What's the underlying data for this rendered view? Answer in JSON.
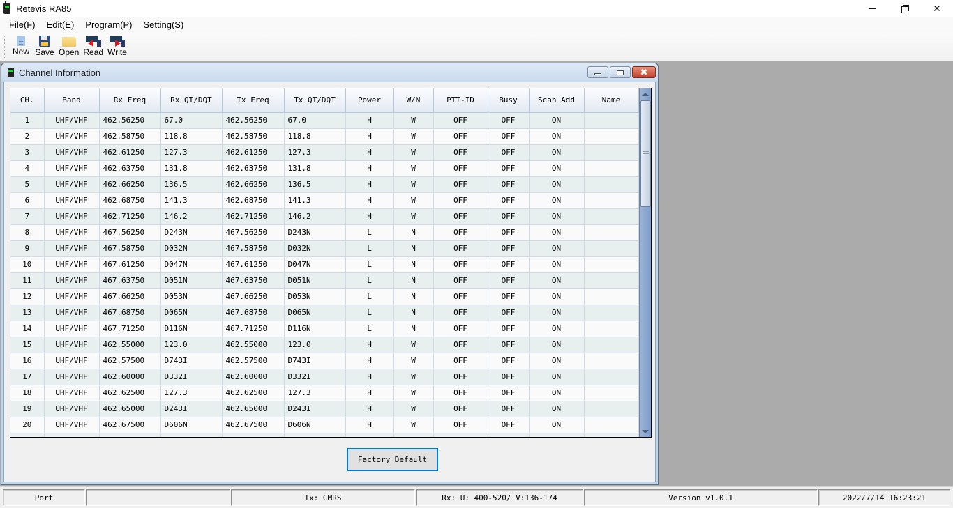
{
  "app": {
    "title": "Retevis RA85",
    "controls": {
      "minimize": "minimize",
      "restore": "restore",
      "close": "✕"
    }
  },
  "menubar": {
    "items": [
      {
        "label": "File(F)"
      },
      {
        "label": "Edit(E)"
      },
      {
        "label": "Program(P)"
      },
      {
        "label": "Setting(S)"
      }
    ]
  },
  "toolbar": {
    "items": [
      {
        "label": "New",
        "icon": "new-file-icon"
      },
      {
        "label": "Save",
        "icon": "floppy-save-icon"
      },
      {
        "label": "Open",
        "icon": "folder-open-icon"
      },
      {
        "label": "Read",
        "icon": "read-from-radio-icon"
      },
      {
        "label": "Write",
        "icon": "write-to-radio-icon"
      }
    ]
  },
  "child_window": {
    "title": "Channel Information",
    "close_glyph": "✖"
  },
  "table": {
    "columns": [
      "CH.",
      "Band",
      "Rx Freq",
      "Rx QT/DQT",
      "Tx Freq",
      "Tx QT/DQT",
      "Power",
      "W/N",
      "PTT-ID",
      "Busy",
      "Scan Add",
      "Name"
    ],
    "rows": [
      [
        "1",
        "UHF/VHF",
        "462.56250",
        "67.0",
        "462.56250",
        "67.0",
        "H",
        "W",
        "OFF",
        "OFF",
        "ON",
        ""
      ],
      [
        "2",
        "UHF/VHF",
        "462.58750",
        "118.8",
        "462.58750",
        "118.8",
        "H",
        "W",
        "OFF",
        "OFF",
        "ON",
        ""
      ],
      [
        "3",
        "UHF/VHF",
        "462.61250",
        "127.3",
        "462.61250",
        "127.3",
        "H",
        "W",
        "OFF",
        "OFF",
        "ON",
        ""
      ],
      [
        "4",
        "UHF/VHF",
        "462.63750",
        "131.8",
        "462.63750",
        "131.8",
        "H",
        "W",
        "OFF",
        "OFF",
        "ON",
        ""
      ],
      [
        "5",
        "UHF/VHF",
        "462.66250",
        "136.5",
        "462.66250",
        "136.5",
        "H",
        "W",
        "OFF",
        "OFF",
        "ON",
        ""
      ],
      [
        "6",
        "UHF/VHF",
        "462.68750",
        "141.3",
        "462.68750",
        "141.3",
        "H",
        "W",
        "OFF",
        "OFF",
        "ON",
        ""
      ],
      [
        "7",
        "UHF/VHF",
        "462.71250",
        "146.2",
        "462.71250",
        "146.2",
        "H",
        "W",
        "OFF",
        "OFF",
        "ON",
        ""
      ],
      [
        "8",
        "UHF/VHF",
        "467.56250",
        "D243N",
        "467.56250",
        "D243N",
        "L",
        "N",
        "OFF",
        "OFF",
        "ON",
        ""
      ],
      [
        "9",
        "UHF/VHF",
        "467.58750",
        "D032N",
        "467.58750",
        "D032N",
        "L",
        "N",
        "OFF",
        "OFF",
        "ON",
        ""
      ],
      [
        "10",
        "UHF/VHF",
        "467.61250",
        "D047N",
        "467.61250",
        "D047N",
        "L",
        "N",
        "OFF",
        "OFF",
        "ON",
        ""
      ],
      [
        "11",
        "UHF/VHF",
        "467.63750",
        "D051N",
        "467.63750",
        "D051N",
        "L",
        "N",
        "OFF",
        "OFF",
        "ON",
        ""
      ],
      [
        "12",
        "UHF/VHF",
        "467.66250",
        "D053N",
        "467.66250",
        "D053N",
        "L",
        "N",
        "OFF",
        "OFF",
        "ON",
        ""
      ],
      [
        "13",
        "UHF/VHF",
        "467.68750",
        "D065N",
        "467.68750",
        "D065N",
        "L",
        "N",
        "OFF",
        "OFF",
        "ON",
        ""
      ],
      [
        "14",
        "UHF/VHF",
        "467.71250",
        "D116N",
        "467.71250",
        "D116N",
        "L",
        "N",
        "OFF",
        "OFF",
        "ON",
        ""
      ],
      [
        "15",
        "UHF/VHF",
        "462.55000",
        "123.0",
        "462.55000",
        "123.0",
        "H",
        "W",
        "OFF",
        "OFF",
        "ON",
        ""
      ],
      [
        "16",
        "UHF/VHF",
        "462.57500",
        "D743I",
        "462.57500",
        "D743I",
        "H",
        "W",
        "OFF",
        "OFF",
        "ON",
        ""
      ],
      [
        "17",
        "UHF/VHF",
        "462.60000",
        "D332I",
        "462.60000",
        "D332I",
        "H",
        "W",
        "OFF",
        "OFF",
        "ON",
        ""
      ],
      [
        "18",
        "UHF/VHF",
        "462.62500",
        "127.3",
        "462.62500",
        "127.3",
        "H",
        "W",
        "OFF",
        "OFF",
        "ON",
        ""
      ],
      [
        "19",
        "UHF/VHF",
        "462.65000",
        "D243I",
        "462.65000",
        "D243I",
        "H",
        "W",
        "OFF",
        "OFF",
        "ON",
        ""
      ],
      [
        "20",
        "UHF/VHF",
        "462.67500",
        "D606N",
        "462.67500",
        "D606N",
        "H",
        "W",
        "OFF",
        "OFF",
        "ON",
        ""
      ]
    ]
  },
  "buttons": {
    "factory_default": "Factory Default"
  },
  "statusbar": {
    "port": "Port",
    "port_value": "",
    "tx": "Tx: GMRS",
    "rx": "Rx: U: 400-520/ V:136-174",
    "version": "Version v1.0.1",
    "datetime": "2022/7/14 16:23:21"
  },
  "colors": {
    "accent_focus": "#0078d7",
    "row_alt": "#e7efef",
    "workspace": "#ababab"
  }
}
